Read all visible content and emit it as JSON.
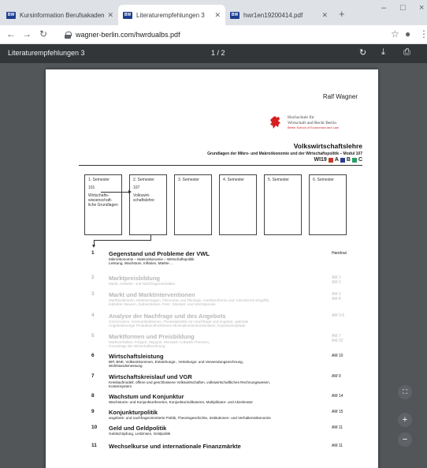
{
  "browser": {
    "tabs": [
      {
        "favicon": "BW",
        "title": "Kursinformation Berufsakademie"
      },
      {
        "favicon": "BW",
        "title": "Literaturempfehlungen 3"
      },
      {
        "favicon": "BW",
        "title": "hwr1en19200414.pdf"
      }
    ],
    "new_tab": "+",
    "window_controls": [
      "–",
      "□",
      "×"
    ],
    "url": "wagner-berlin.com/hwrdualbs.pdf"
  },
  "pdf_toolbar": {
    "title": "Literaturempfehlungen 3",
    "page_indicator": "1 / 2"
  },
  "document": {
    "author": "Ralf Wagner",
    "school": {
      "line1": "Hochschule für",
      "line2": "Wirtschaft und Recht Berlin",
      "line3": "Berlin School of Economics and Law",
      "accent": "#d42022"
    },
    "course_title": "Volkswirtschaftslehre",
    "subtitle": "Grundlagen der Mikro- und Makroökonomie und der Wirtschaftspolitik – Modul 107",
    "code_prefix": "WI19",
    "code_letters": [
      "A",
      "B",
      "C"
    ],
    "code_colors": [
      "#c0392b",
      "#2b3f8f",
      "#27a064"
    ],
    "semesters": [
      {
        "label": "1. Semester",
        "code": "101",
        "desc": "Wirtschafts-wissenschaft-liche Grundlagen"
      },
      {
        "label": "2. Semester",
        "code": "107",
        "desc": "Volkswirt-schaftslehre"
      },
      {
        "label": "3. Semester",
        "code": "",
        "desc": ""
      },
      {
        "label": "4. Semester",
        "code": "",
        "desc": ""
      },
      {
        "label": "5. Semester",
        "code": "",
        "desc": ""
      },
      {
        "label": "6. Semester",
        "code": "",
        "desc": ""
      }
    ],
    "topics": [
      {
        "num": "1",
        "head": "Gegenstand und Probleme der VWL",
        "sub": "Mikroökonomie – Makroökonomie – Wirtschaftspolitik\nLeistung, Wachstum, Inflation, Märkte ...",
        "ref": "Handout"
      },
      {
        "num": "2",
        "head": "Marktpreisbildung",
        "sub": "Markt, Anbieter- und Nachfragerverhalten",
        "ref": "AM 1\nAM 2"
      },
      {
        "num": "3",
        "head": "Markt und Marktinterventionen",
        "sub": "Marktfunktionen, Marktversagen, Ökonomie und Ökologie, marktkonforme und -inkonforme Eingriffe,\nindirekte Steuern, Subventionen, Fest-, Mindest- und Höchstpreise",
        "ref": "AM 2\nAM 8"
      },
      {
        "num": "4",
        "head": "Analyse der Nachfrage und des Angebots",
        "sub": "Grenznutzen, Konsumfunktionen, Preiselastizität von Nachfrage und Angebot, optimale\nAngebotsmenge Produktionsfunktionen Minimalkostenkombination, Expansionspfade",
        "ref": "AM 3-6"
      },
      {
        "num": "5",
        "head": "Marktformen und Preisbildung",
        "sub": "Marktverhalten, Polypol, Oligopol, Monopol, Cobweb-Theorem,\nGrundzüge der Wirtschaftsordnung",
        "ref": "AM 7\nAM 20"
      },
      {
        "num": "6",
        "head": "Wirtschaftsleistung",
        "sub": "BIP, BNE, Volkseinkommen, Entstehungs-, Verteilungs- und Verwendungsrechnung,\nWohlstandsmessung",
        "ref": "AM 10"
      },
      {
        "num": "7",
        "head": "Wirtschaftskreislauf und VGR",
        "sub": "Kreislaufmodell, offene und geschlossene Volkswirtschaften, volkswirtschaftliches Rechnungswesen,\nKontensystem",
        "ref": "AM 9"
      },
      {
        "num": "8",
        "head": "Wachstum und Konjunktur",
        "sub": "Wachstums- und Konjunkturtheorien, Konjunkturindikatoren, Multiplikator- und Akzelerator",
        "ref": "AM 14"
      },
      {
        "num": "9",
        "head": "Konjunkturpolitik",
        "sub": "angebots- und nachfrageorientierte Politik, Theoriegeschichte, Institutionen- und Verhaltensökonomie",
        "ref": "AM 15"
      },
      {
        "num": "10",
        "head": "Geld und Geldpolitik",
        "sub": "Geldschöpfung, Leitzinsen, Geldpolitik",
        "ref": "AM 11"
      },
      {
        "num": "11",
        "head": "Wechselkurse und internationale Finanzmärkte",
        "sub": "",
        "ref": "AM 11"
      }
    ]
  },
  "zoom_controls": {
    "fit": "⛶",
    "zoom_in": "+",
    "zoom_out": "−"
  }
}
